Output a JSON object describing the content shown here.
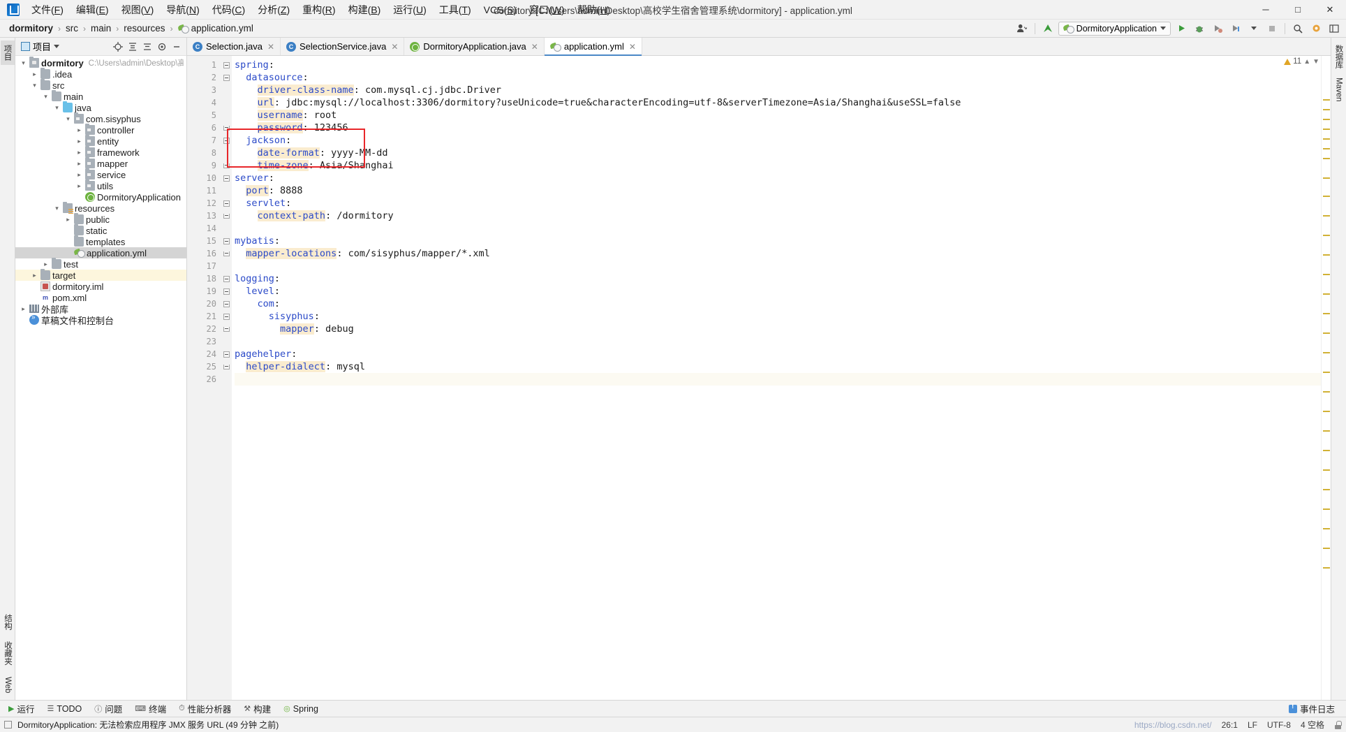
{
  "window": {
    "title": "dormitory [C:\\Users\\admin\\Desktop\\高校学生宿舍管理系统\\dormitory] - application.yml",
    "minimize": "─",
    "maximize": "□",
    "close": "✕"
  },
  "menu": [
    {
      "label": "文件(F)"
    },
    {
      "label": "编辑(E)"
    },
    {
      "label": "视图(V)"
    },
    {
      "label": "导航(N)"
    },
    {
      "label": "代码(C)"
    },
    {
      "label": "分析(Z)"
    },
    {
      "label": "重构(R)"
    },
    {
      "label": "构建(B)"
    },
    {
      "label": "运行(U)"
    },
    {
      "label": "工具(T)"
    },
    {
      "label": "VCS(S)"
    },
    {
      "label": "窗口(W)"
    },
    {
      "label": "帮助(H)"
    }
  ],
  "breadcrumb": {
    "items": [
      "dormitory",
      "src",
      "main",
      "resources",
      "application.yml"
    ],
    "separator": "›"
  },
  "toolbar": {
    "profile_icon": "user-profile-icon",
    "update_icon": "update-arrow-icon",
    "run_config": "DormitoryApplication",
    "run": "▶",
    "debug": "debug-icon",
    "run_coverage": "coverage-icon",
    "profiler": "profiler-icon",
    "stop": "■",
    "search": "⌕",
    "settings": "gear-icon",
    "layout": "layout-icon"
  },
  "left_strip": {
    "top": [
      {
        "label": "项目",
        "selected": true
      }
    ],
    "bottom": [
      {
        "label": "结构"
      },
      {
        "label": "收藏夹"
      },
      {
        "label": "Web"
      }
    ]
  },
  "right_strip": {
    "items": [
      {
        "label": "数据库"
      },
      {
        "label": "Maven"
      }
    ]
  },
  "project_panel": {
    "title": "项目",
    "icons": [
      "locate-icon",
      "expand-all-icon",
      "collapse-all-icon",
      "gear-icon",
      "hide-icon"
    ],
    "tree": [
      {
        "depth": 0,
        "label": "dormitory",
        "path": "C:\\Users\\admin\\Desktop\\高校学",
        "icon": "module-icon",
        "arrow": "down",
        "bold": true
      },
      {
        "depth": 1,
        "label": ".idea",
        "icon": "folder-icon",
        "arrow": "right"
      },
      {
        "depth": 1,
        "label": "src",
        "icon": "folder-icon",
        "arrow": "down"
      },
      {
        "depth": 2,
        "label": "main",
        "icon": "folder-icon",
        "arrow": "down"
      },
      {
        "depth": 3,
        "label": "java",
        "icon": "source-folder-icon",
        "arrow": "down"
      },
      {
        "depth": 4,
        "label": "com.sisyphus",
        "icon": "package-icon",
        "arrow": "down"
      },
      {
        "depth": 5,
        "label": "controller",
        "icon": "package-icon",
        "arrow": "right"
      },
      {
        "depth": 5,
        "label": "entity",
        "icon": "package-icon",
        "arrow": "right"
      },
      {
        "depth": 5,
        "label": "framework",
        "icon": "package-icon",
        "arrow": "right"
      },
      {
        "depth": 5,
        "label": "mapper",
        "icon": "package-icon",
        "arrow": "right"
      },
      {
        "depth": 5,
        "label": "service",
        "icon": "package-icon",
        "arrow": "right"
      },
      {
        "depth": 5,
        "label": "utils",
        "icon": "package-icon",
        "arrow": "right"
      },
      {
        "depth": 5,
        "label": "DormitoryApplication",
        "icon": "spring-class-icon",
        "arrow": "none"
      },
      {
        "depth": 3,
        "label": "resources",
        "icon": "resources-folder-icon",
        "arrow": "down"
      },
      {
        "depth": 4,
        "label": "public",
        "icon": "folder-icon",
        "arrow": "right"
      },
      {
        "depth": 4,
        "label": "static",
        "icon": "folder-icon",
        "arrow": "none"
      },
      {
        "depth": 4,
        "label": "templates",
        "icon": "folder-icon",
        "arrow": "none"
      },
      {
        "depth": 4,
        "label": "application.yml",
        "icon": "yaml-spring-icon",
        "arrow": "none",
        "selected": true
      },
      {
        "depth": 2,
        "label": "test",
        "icon": "folder-icon",
        "arrow": "right"
      },
      {
        "depth": 1,
        "label": "target",
        "icon": "folder-icon",
        "arrow": "right",
        "highlight": true
      },
      {
        "depth": 1,
        "label": "dormitory.iml",
        "icon": "iml-icon",
        "arrow": "none"
      },
      {
        "depth": 1,
        "label": "pom.xml",
        "icon": "maven-xml-icon",
        "arrow": "none"
      },
      {
        "depth": 0,
        "label": "外部库",
        "icon": "library-icon",
        "arrow": "right"
      },
      {
        "depth": 0,
        "label": "草稿文件和控制台",
        "icon": "scratch-console-icon",
        "arrow": "none"
      }
    ]
  },
  "editor_tabs": [
    {
      "label": "Selection.java",
      "icon": "java-class-icon",
      "active": false
    },
    {
      "label": "SelectionService.java",
      "icon": "java-class-icon",
      "active": false
    },
    {
      "label": "DormitoryApplication.java",
      "icon": "spring-class-icon",
      "active": false
    },
    {
      "label": "application.yml",
      "icon": "yaml-spring-icon",
      "active": true
    }
  ],
  "editor": {
    "inspection_count": "11",
    "caret_position": "26:1",
    "line_separator": "LF",
    "encoding": "UTF-8",
    "indent": "4 空格",
    "lines": [
      {
        "n": 1,
        "indent": 0,
        "key": "spring",
        "sep": ":",
        "value": "",
        "fold": "minus",
        "hl": false
      },
      {
        "n": 2,
        "indent": 2,
        "key": "datasource",
        "sep": ":",
        "value": "",
        "fold": "minus",
        "hl": false
      },
      {
        "n": 3,
        "indent": 4,
        "key": "driver-class-name",
        "sep": ":",
        "value": " com.mysql.cj.jdbc.Driver",
        "fold": "",
        "hl": true
      },
      {
        "n": 4,
        "indent": 4,
        "key": "url",
        "sep": ":",
        "value": " jdbc:mysql://localhost:3306/dormitory?useUnicode=true&characterEncoding=utf-8&serverTimezone=Asia/Shanghai&useSSL=false",
        "fold": "",
        "hl": true
      },
      {
        "n": 5,
        "indent": 4,
        "key": "username",
        "sep": ":",
        "value": " root",
        "fold": "",
        "hl": true
      },
      {
        "n": 6,
        "indent": 4,
        "key": "password",
        "sep": ":",
        "value": " 123456",
        "fold": "end",
        "hl": true
      },
      {
        "n": 7,
        "indent": 2,
        "key": "jackson",
        "sep": ":",
        "value": "",
        "fold": "minus",
        "hl": false
      },
      {
        "n": 8,
        "indent": 4,
        "key": "date-format",
        "sep": ":",
        "value": " yyyy-MM-dd",
        "fold": "",
        "hl": true
      },
      {
        "n": 9,
        "indent": 4,
        "key": "time-zone",
        "sep": ":",
        "value": " Asia/Shanghai",
        "fold": "end",
        "hl": true
      },
      {
        "n": 10,
        "indent": 0,
        "key": "server",
        "sep": ":",
        "value": "",
        "fold": "minus",
        "hl": false
      },
      {
        "n": 11,
        "indent": 2,
        "key": "port",
        "sep": ":",
        "value": " 8888",
        "fold": "",
        "hl": true
      },
      {
        "n": 12,
        "indent": 2,
        "key": "servlet",
        "sep": ":",
        "value": "",
        "fold": "minus",
        "hl": false
      },
      {
        "n": 13,
        "indent": 4,
        "key": "context-path",
        "sep": ":",
        "value": " /dormitory",
        "fold": "end",
        "hl": true
      },
      {
        "n": 14,
        "indent": 0,
        "key": "",
        "sep": "",
        "value": "",
        "fold": "",
        "hl": false
      },
      {
        "n": 15,
        "indent": 0,
        "key": "mybatis",
        "sep": ":",
        "value": "",
        "fold": "minus",
        "hl": false
      },
      {
        "n": 16,
        "indent": 2,
        "key": "mapper-locations",
        "sep": ":",
        "value": " com/sisyphus/mapper/*.xml",
        "fold": "end",
        "hl": true
      },
      {
        "n": 17,
        "indent": 0,
        "key": "",
        "sep": "",
        "value": "",
        "fold": "",
        "hl": false
      },
      {
        "n": 18,
        "indent": 0,
        "key": "logging",
        "sep": ":",
        "value": "",
        "fold": "minus",
        "hl": false
      },
      {
        "n": 19,
        "indent": 2,
        "key": "level",
        "sep": ":",
        "value": "",
        "fold": "minus",
        "hl": false
      },
      {
        "n": 20,
        "indent": 4,
        "key": "com",
        "sep": ":",
        "value": "",
        "fold": "minus",
        "hl": false
      },
      {
        "n": 21,
        "indent": 6,
        "key": "sisyphus",
        "sep": ":",
        "value": "",
        "fold": "minus",
        "hl": false
      },
      {
        "n": 22,
        "indent": 8,
        "key": "mapper",
        "sep": ":",
        "value": " debug",
        "fold": "end",
        "hl": true
      },
      {
        "n": 23,
        "indent": 0,
        "key": "",
        "sep": "",
        "value": "",
        "fold": "",
        "hl": false
      },
      {
        "n": 24,
        "indent": 0,
        "key": "pagehelper",
        "sep": ":",
        "value": "",
        "fold": "minus",
        "hl": false
      },
      {
        "n": 25,
        "indent": 2,
        "key": "helper-dialect",
        "sep": ":",
        "value": " mysql",
        "fold": "end",
        "hl": true
      },
      {
        "n": 26,
        "indent": 0,
        "key": "",
        "sep": "",
        "value": "",
        "fold": "",
        "hl": false,
        "current": true
      }
    ],
    "annotation": {
      "color": "#e8262a",
      "label": "jackson-config-highlight-box"
    }
  },
  "tool_windows": {
    "items": [
      {
        "label": "运行",
        "icon": "play-icon"
      },
      {
        "label": "TODO",
        "icon": "todo-icon"
      },
      {
        "label": "问题",
        "icon": "problems-icon"
      },
      {
        "label": "终端",
        "icon": "terminal-icon"
      },
      {
        "label": "性能分析器",
        "icon": "profiler-icon"
      },
      {
        "label": "构建",
        "icon": "build-icon"
      },
      {
        "label": "Spring",
        "icon": "spring-icon"
      }
    ],
    "right": [
      {
        "label": "事件日志",
        "icon": "event-log-icon"
      }
    ]
  },
  "status": {
    "message": "DormitoryApplication: 无法检索应用程序 JMX 服务 URL (49 分钟 之前)",
    "url_hint": "https://blog.csdn.net/",
    "caret": "26:1",
    "line_sep": "LF",
    "encoding": "UTF-8",
    "indent": "4 空格",
    "lock": "lock-icon"
  }
}
